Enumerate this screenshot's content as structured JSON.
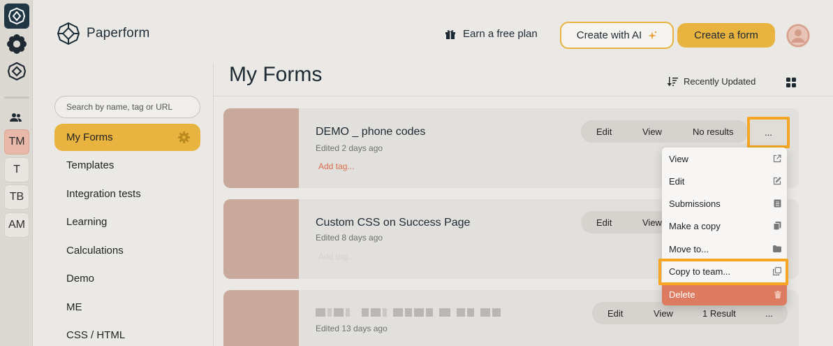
{
  "app": {
    "name": "Paperform",
    "colors": {
      "accent": "#e8b33e",
      "highlight": "#f6a623",
      "danger": "#dc7b5f",
      "thumb": "#c9a99b"
    }
  },
  "rail": {
    "teams_icon": "people-icon",
    "teams": [
      "TM",
      "T",
      "TB",
      "AM"
    ]
  },
  "header": {
    "earn_label": "Earn a free plan",
    "ai_button": "Create with AI",
    "create_button": "Create a form"
  },
  "sidebar": {
    "search_placeholder": "Search by name, tag or URL",
    "items": [
      {
        "label": "My Forms",
        "active": true
      },
      {
        "label": "Templates"
      },
      {
        "label": "Integration tests"
      },
      {
        "label": "Learning"
      },
      {
        "label": "Calculations"
      },
      {
        "label": "Demo"
      },
      {
        "label": "ME"
      },
      {
        "label": "CSS / HTML"
      }
    ]
  },
  "main": {
    "title": "My Forms",
    "sort_label": "Recently Updated",
    "forms": [
      {
        "title": "DEMO _ phone codes",
        "edited": "Edited 2 days ago",
        "tag_placeholder": "Add tag...",
        "actions": [
          "Edit",
          "View",
          "No results",
          "..."
        ]
      },
      {
        "title": "Custom CSS on Success Page",
        "edited": "Edited 8 days ago",
        "tag_placeholder": "Add tag...",
        "actions": [
          "Edit",
          "View"
        ]
      },
      {
        "title": "",
        "edited": "Edited 13 days ago",
        "actions": [
          "Edit",
          "View",
          "1 Result",
          "..."
        ]
      }
    ]
  },
  "menu": {
    "items": [
      {
        "label": "View",
        "icon": "external-link-icon"
      },
      {
        "label": "Edit",
        "icon": "pencil-square-icon"
      },
      {
        "label": "Submissions",
        "icon": "list-document-icon"
      },
      {
        "label": "Make a copy",
        "icon": "copy-icon"
      },
      {
        "label": "Move to...",
        "icon": "folder-icon"
      },
      {
        "label": "Copy to team...",
        "icon": "duplicate-icon"
      },
      {
        "label": "Delete",
        "icon": "trash-icon"
      }
    ]
  }
}
